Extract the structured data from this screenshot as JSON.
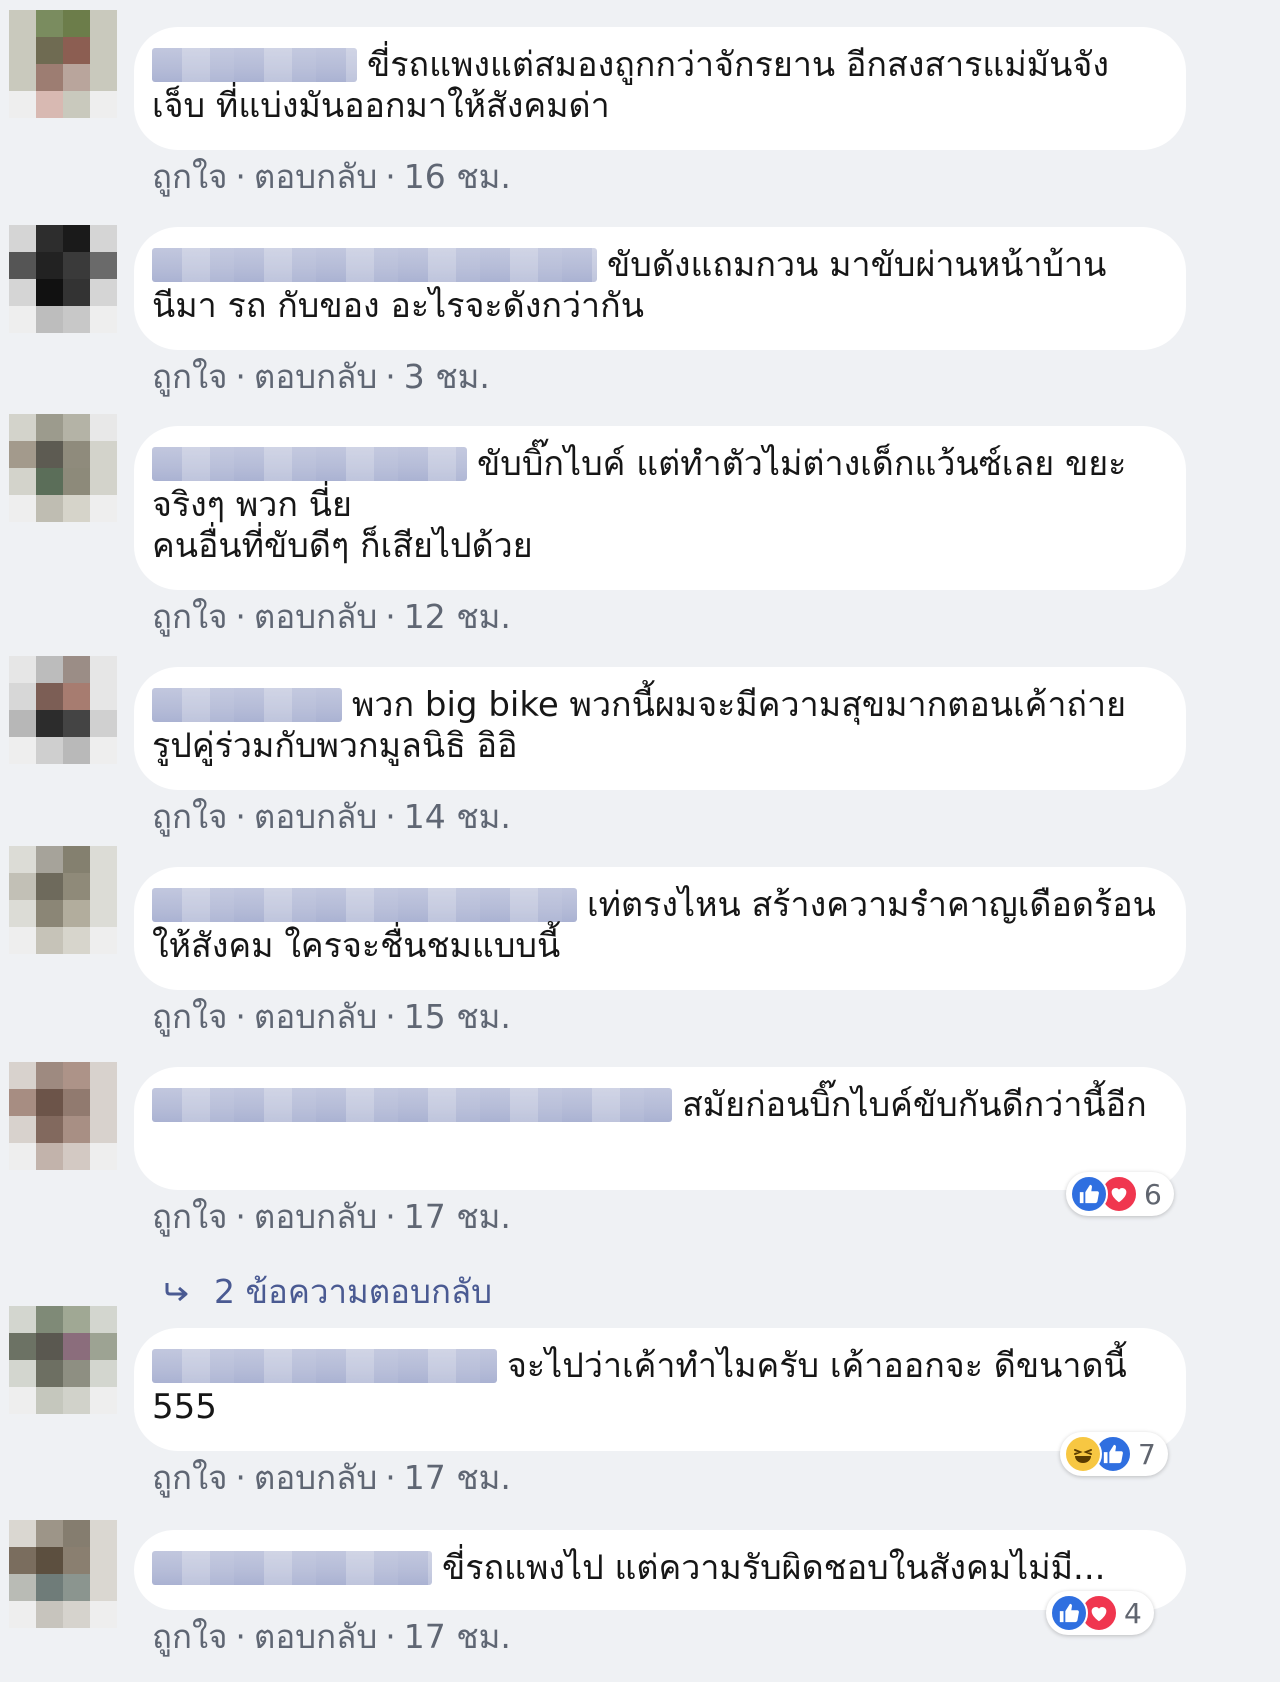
{
  "comments": [
    {
      "text": "ขี่รถแพงแต่สมองถูกกว่าจักรยาน อีกสงสารแม่มันจังเจ็บ ที่แบ่งมันออกมาให้สังคมด่า",
      "like": "ถูกใจ",
      "reply": "ตอบกลับ",
      "time": "16 ชม."
    },
    {
      "text": "ขับดังแถมกวน มาขับผ่านหน้าบ้าน นีมา รถ กับของ อะไรจะดังกว่ากัน",
      "like": "ถูกใจ",
      "reply": "ตอบกลับ",
      "time": "3 ชม."
    },
    {
      "text": "ขับบิ๊กไบค์ แต่ทำตัวไม่ต่างเด็กแว้นซ์เลย ขยะจริงๆ พวก นี่ย\nคนอื่นที่ขับดีๆ ก็เสียไปด้วย",
      "like": "ถูกใจ",
      "reply": "ตอบกลับ",
      "time": "12 ชม."
    },
    {
      "text": "พวก big bike พวกนี้ผมจะมีความสุขมากตอนเค้าถ่ายรูปคู่ร่วมกับพวกมูลนิธิ อิอิ",
      "like": "ถูกใจ",
      "reply": "ตอบกลับ",
      "time": "14 ชม."
    },
    {
      "text": "เท่ตรงไหน สร้างความรำคาญเดือดร้อนให้สังคม ใครจะชื่นชมแบบนี้",
      "like": "ถูกใจ",
      "reply": "ตอบกลับ",
      "time": "15 ชม."
    },
    {
      "text": "สมัยก่อนบิ๊กไบค์ขับกันดีกว่านี้อีก",
      "like": "ถูกใจ",
      "reply": "ตอบกลับ",
      "time": "17 ชม.",
      "reactions": {
        "icons": [
          "like-icon",
          "love-icon"
        ],
        "count": "6"
      }
    },
    {
      "text": "จะไปว่าเค้าทำไมครับ เค้าออกจะ ดีขนาดนี้ 555",
      "like": "ถูกใจ",
      "reply": "ตอบกลับ",
      "time": "17 ชม.",
      "reactions": {
        "icons": [
          "haha-icon",
          "like-icon"
        ],
        "count": "7"
      }
    },
    {
      "text": "ขี่รถแพงไป แต่ความรับผิดชอบในสังคมไม่มี...",
      "like": "ถูกใจ",
      "reply": "ตอบกลับ",
      "time": "17 ชม.",
      "reactions": {
        "icons": [
          "like-icon",
          "love-icon"
        ],
        "count": "4"
      }
    }
  ],
  "replies_link": "2 ข้อความตอบกลับ",
  "colors": {
    "background": "#eff1f4",
    "bubble": "#ffffff",
    "meta_text": "#5f6673",
    "link": "#4a5a92",
    "like_blue": "#2f6fe0",
    "love_red": "#f0364f",
    "haha_yellow": "#f7c742"
  }
}
